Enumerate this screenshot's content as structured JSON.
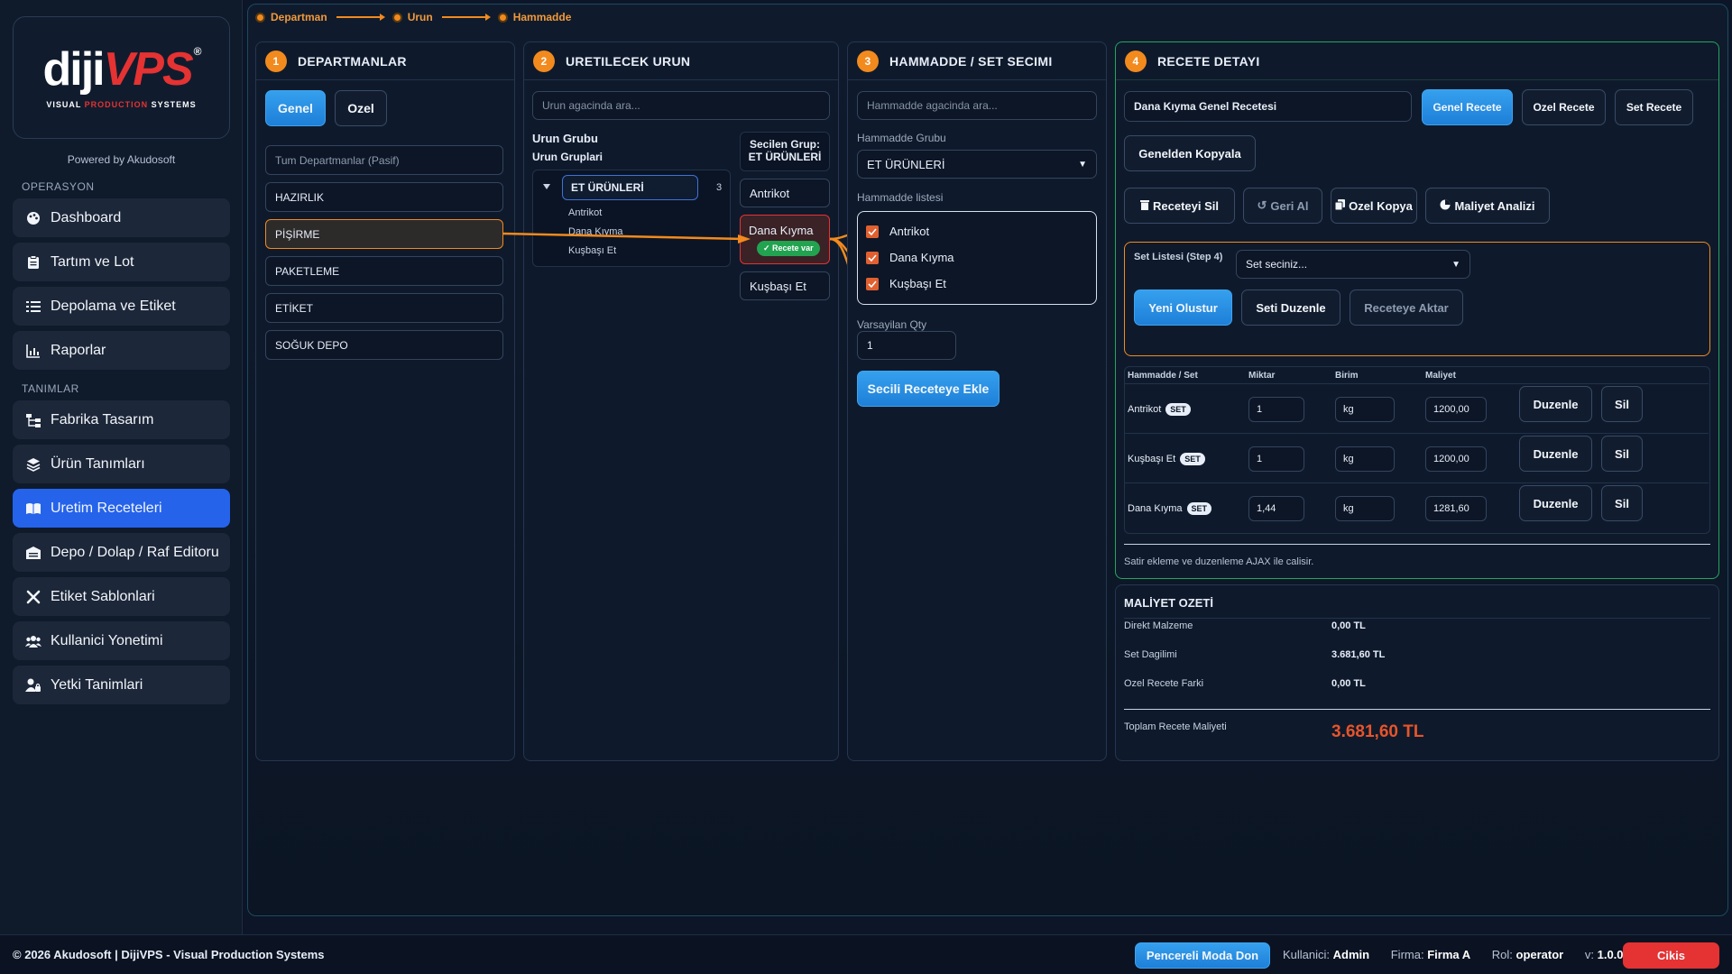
{
  "sidebar": {
    "logo": {
      "part1": "diji",
      "part2": "VPS",
      "reg": "®",
      "sub_visual": "VISUAL ",
      "sub_production": "PRODUCTION",
      "sub_systems": " SYSTEMS"
    },
    "powered_by": "Powered by Akudosoft",
    "section_operasyon": "OPERASYON",
    "section_tanimlar": "TANIMLAR",
    "items": [
      {
        "label": "Dashboard",
        "icon": "palette-icon"
      },
      {
        "label": "Tartım ve Lot",
        "icon": "clipboard-icon"
      },
      {
        "label": "Depolama ve Etiket",
        "icon": "list-icon"
      },
      {
        "label": "Raporlar",
        "icon": "chart-icon"
      },
      {
        "label": "Fabrika Tasarım",
        "icon": "sitemap-icon"
      },
      {
        "label": "Ürün Tanımları",
        "icon": "layers-icon"
      },
      {
        "label": "Uretim Receteleri",
        "icon": "book-icon",
        "active": true
      },
      {
        "label": "Depo / Dolap / Raf Editoru",
        "icon": "warehouse-icon"
      },
      {
        "label": "Etiket Sablonlari",
        "icon": "tools-icon"
      },
      {
        "label": "Kullanici Yonetimi",
        "icon": "users-icon"
      },
      {
        "label": "Yetki Tanimlari",
        "icon": "user-lock-icon"
      }
    ]
  },
  "breadcrumb": [
    "Departman",
    "Urun",
    "Hammadde"
  ],
  "panel1": {
    "num": "1",
    "title": "DEPARTMANLAR",
    "tab_genel": "Genel",
    "tab_ozel": "Ozel",
    "items": [
      "Tum Departmanlar (Pasif)",
      "HAZIRLIK",
      "PİŞİRME",
      "PAKETLEME",
      "ETİKET",
      "SOĞUK DEPO"
    ]
  },
  "panel2": {
    "num": "2",
    "title": "URETILECEK URUN",
    "search_placeholder": "Urun agacinda ara...",
    "group_title": "Urun Grubu",
    "group_subtitle": "Urun Gruplari",
    "tree_root": "ET ÜRÜNLERİ",
    "tree_count": "3",
    "tree_children": [
      "Antrikot",
      "Dana Kıyma",
      "Kuşbaşı Et"
    ],
    "selected_group_label": "Secilen Grup:",
    "selected_group_value": "ET ÜRÜNLERİ",
    "products": [
      "Antrikot",
      "Dana Kıyma",
      "Kuşbaşı Et"
    ],
    "recipe_badge": "✓ Recete var"
  },
  "panel3": {
    "num": "3",
    "title": "HAMMADDE / SET SECIMI",
    "search_placeholder": "Hammadde agacinda ara...",
    "group_label": "Hammadde Grubu",
    "group_value": "ET ÜRÜNLERİ",
    "list_label": "Hammadde listesi",
    "list_items": [
      "Antrikot",
      "Dana Kıyma",
      "Kuşbaşı Et"
    ],
    "qty_label": "Varsayilan Qty",
    "qty_value": "1",
    "add_button": "Secili Receteye Ekle"
  },
  "panel4": {
    "num": "4",
    "title": "RECETE DETAYI",
    "recipe_name": "Dana Kıyma Genel Recetesi",
    "btn_genel": "Genel Recete",
    "btn_ozel": "Ozel Recete",
    "btn_set": "Set Recete",
    "btn_copy_general": "Genelden Kopyala",
    "btn_delete": "Receteyi Sil",
    "btn_undo": "Geri Al",
    "btn_special_copy": "Ozel Kopya",
    "btn_cost": "Maliyet Analizi",
    "set_list_label": "Set Listesi (Step 4)",
    "set_select": "Set seciniz...",
    "btn_new": "Yeni Olustur",
    "btn_edit_set": "Seti Duzenle",
    "btn_transfer": "Receteye Aktar",
    "columns": [
      "Hammadde / Set",
      "Miktar",
      "Birim",
      "Maliyet"
    ],
    "rows": [
      {
        "name": "Antrikot",
        "badge": "SET",
        "qty": "1",
        "unit": "kg",
        "cost": "1200,00",
        "edit": "Duzenle",
        "del": "Sil"
      },
      {
        "name": "Kuşbaşı Et",
        "badge": "SET",
        "qty": "1",
        "unit": "kg",
        "cost": "1200,00",
        "edit": "Duzenle",
        "del": "Sil"
      },
      {
        "name": "Dana Kıyma",
        "badge": "SET",
        "qty": "1,44",
        "unit": "kg",
        "cost": "1281,60",
        "edit": "Duzenle",
        "del": "Sil"
      }
    ],
    "note": "Satir ekleme ve duzenleme AJAX ile calisir."
  },
  "cost_summary": {
    "title": "MALİYET OZETİ",
    "rows": [
      {
        "label": "Direkt Malzeme",
        "value": "0,00 TL"
      },
      {
        "label": "Set Dagilimi",
        "value": "3.681,60 TL"
      },
      {
        "label": "Ozel Recete Farki",
        "value": "0,00 TL"
      }
    ],
    "total_label": "Toplam Recete Maliyeti",
    "total_value": "3.681,60 TL"
  },
  "footer": {
    "copyright": "© 2026 Akudosoft | DijiVPS - Visual Production Systems",
    "window_mode": "Pencereli Moda Don",
    "user_label": "Kullanici:",
    "user_value": "Admin",
    "firm_label": "Firma:",
    "firm_value": "Firma A",
    "role_label": "Rol:",
    "role_value": "operator",
    "version_label": "v:",
    "version_value": "1.0.0",
    "logout": "Cikis"
  },
  "colors": {
    "accent": "#f28a1e",
    "primary": "#2563eb",
    "success": "#27a35e",
    "danger": "#e53232",
    "cost_total": "#e8542a"
  }
}
